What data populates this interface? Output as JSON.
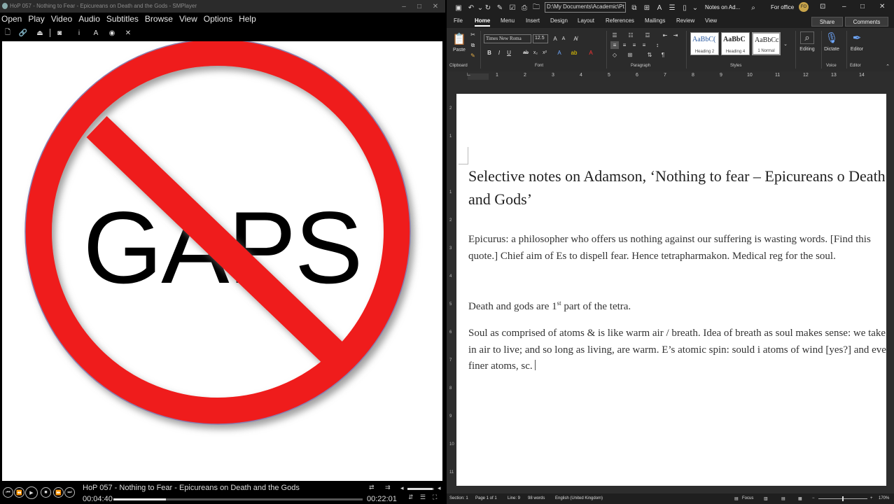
{
  "smplayer": {
    "window_title": "HoP 057 - Nothing to Fear - Epicureans on Death and the Gods - SMPlayer",
    "menu": [
      "Open",
      "Play",
      "Video",
      "Audio",
      "Subtitles",
      "Browse",
      "View",
      "Options",
      "Help"
    ],
    "video_text": "GAPS",
    "media_title": "HoP 057 - Nothing to Fear - Epicureans on Death and the Gods",
    "time_current": "00:04:40",
    "time_total": "00:22:01",
    "progress": 0.212,
    "volume": 0.95,
    "colors": {
      "prohibition_red": "#ef1b1b",
      "background": "#000000"
    }
  },
  "word": {
    "path": "D:\\My Documents\\Academic\\Pt",
    "doc_title": "Notes on Ad...",
    "search_icon": "search-icon",
    "account_label": "For office",
    "avatar_initials": "FO",
    "tabs": [
      "File",
      "Home",
      "Menu",
      "Insert",
      "Design",
      "Layout",
      "References",
      "Mailings",
      "Review",
      "View"
    ],
    "active_tab": "Home",
    "share": "Share",
    "comments": "Comments",
    "ribbon": {
      "paste": "Paste",
      "font_name": "Times New Roma",
      "font_size": "12.5",
      "styles": [
        {
          "preview": "AaBbC(",
          "name": "Heading 2"
        },
        {
          "preview": "AaBbC",
          "name": "Heading 4"
        },
        {
          "preview": "AaBbCcl",
          "name": "1 Normal"
        }
      ],
      "editing": "Editing",
      "dictate": "Dictate",
      "editor": "Editor",
      "groups": [
        "Clipboard",
        "Font",
        "Paragraph",
        "Styles",
        "Voice",
        "Editor"
      ]
    },
    "ruler_numbers": [
      "1",
      "2",
      "3",
      "4",
      "5",
      "6",
      "7",
      "8",
      "9",
      "10",
      "11",
      "12",
      "13",
      "14"
    ],
    "vruler_numbers": [
      "2",
      "1",
      "1",
      "2",
      "3",
      "4",
      "5",
      "6",
      "7",
      "8",
      "9",
      "10",
      "11"
    ],
    "document": {
      "title": "Selective notes on Adamson, ‘Nothing to fear – Epicureans o Death and Gods’",
      "p1": "Epicurus: a philosopher who offers us nothing against our suffering is wasting words. [Find this quote.] Chief aim of Es to dispell fear. Hence tetrapharmakon. Medical reg for the soul.",
      "p2_before": "Death and gods are 1",
      "p2_sup": "st",
      "p2_after": " part of the tetra.",
      "p3": "Soul as comprised of atoms & is like warm air / breath. Idea of breath as soul makes sense: we take in air to live; and so long as living, are warm. E’s atomic spin: sould i atoms of wind [yes?] and even finer atoms, sc."
    },
    "status": {
      "section": "Section: 1",
      "page": "Page 1 of 1",
      "line": "Line: 9",
      "words": "98 words",
      "language": "English (United Kingdom)",
      "focus": "Focus",
      "zoom": "170%"
    },
    "colors": {
      "page": "#ffffff",
      "chrome": "#2b2b2b",
      "avatar": "#c8a44a"
    }
  }
}
